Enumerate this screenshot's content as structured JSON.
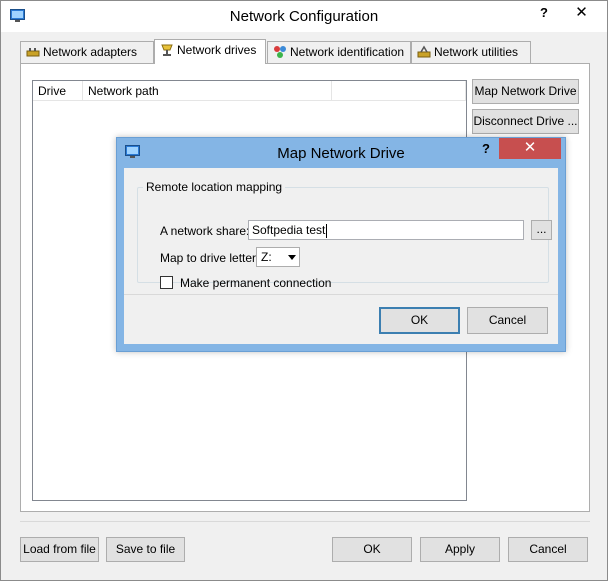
{
  "window": {
    "title": "Network Configuration",
    "help_label": "?",
    "close_label": "✕"
  },
  "tabs": [
    {
      "label": "Network adapters",
      "icon": "network-adapter-icon",
      "active": false
    },
    {
      "label": "Network drives",
      "icon": "network-drive-icon",
      "active": true
    },
    {
      "label": "Network identification",
      "icon": "network-identification-icon",
      "active": false
    },
    {
      "label": "Network utilities",
      "icon": "network-utilities-icon",
      "active": false
    }
  ],
  "drives_list": {
    "columns": [
      "Drive",
      "Network path",
      ""
    ],
    "rows": []
  },
  "side_buttons": {
    "map": "Map Network Drive",
    "disconnect": "Disconnect Drive ..."
  },
  "bottom_buttons": {
    "load": "Load from file",
    "save": "Save to file",
    "ok": "OK",
    "apply": "Apply",
    "cancel": "Cancel"
  },
  "dialog": {
    "title": "Map Network Drive",
    "help_label": "?",
    "close_label": "✕",
    "group_label": "Remote location mapping",
    "share_label": "A network share:",
    "share_value": "Softpedia test",
    "browse_label": "...",
    "letter_label": "Map to drive letter:",
    "letter_value": "Z:",
    "permanent_label": "Make permanent connection",
    "permanent_checked": false,
    "ok": "OK",
    "cancel": "Cancel"
  },
  "colors": {
    "dialog_frame": "#84b5e5",
    "close_red": "#c74f4f",
    "default_button_border": "#3c7fb1"
  }
}
